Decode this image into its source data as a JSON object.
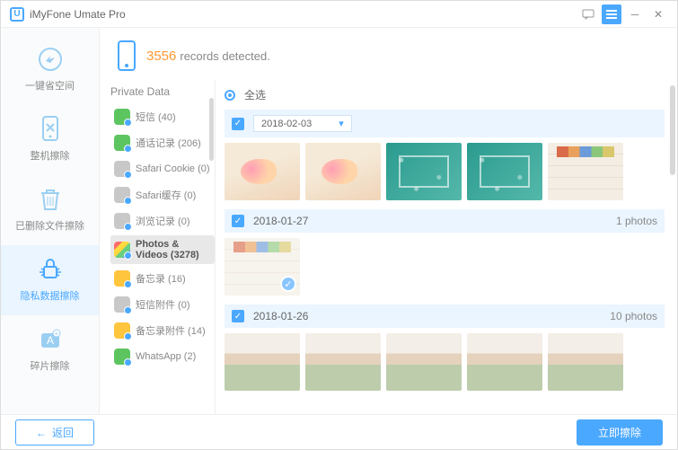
{
  "app": {
    "title": "iMyFone Umate Pro"
  },
  "nav": [
    {
      "label": "一键省空间"
    },
    {
      "label": "整机擦除"
    },
    {
      "label": "已删除文件擦除"
    },
    {
      "label": "隐私数据擦除"
    },
    {
      "label": "碎片擦除"
    }
  ],
  "header": {
    "count": "3556",
    "text": "records detected."
  },
  "panel": {
    "title": "Private Data",
    "items": [
      {
        "label": "短信 (40)"
      },
      {
        "label": "通话记录 (206)"
      },
      {
        "label": "Safari Cookie (0)"
      },
      {
        "label": "Safari缓存 (0)"
      },
      {
        "label": "浏览记录 (0)"
      },
      {
        "label": "Photos & Videos (3278)"
      },
      {
        "label": "备忘录 (16)"
      },
      {
        "label": "短信附件 (0)"
      },
      {
        "label": "备忘录附件 (14)"
      },
      {
        "label": "WhatsApp (2)"
      }
    ]
  },
  "gallery": {
    "selectAll": "全选",
    "groups": [
      {
        "date": "2018-02-03",
        "count": ""
      },
      {
        "date": "2018-01-27",
        "count": "1 photos"
      },
      {
        "date": "2018-01-26",
        "count": "10 photos"
      }
    ]
  },
  "footer": {
    "back": "返回",
    "erase": "立即擦除"
  }
}
